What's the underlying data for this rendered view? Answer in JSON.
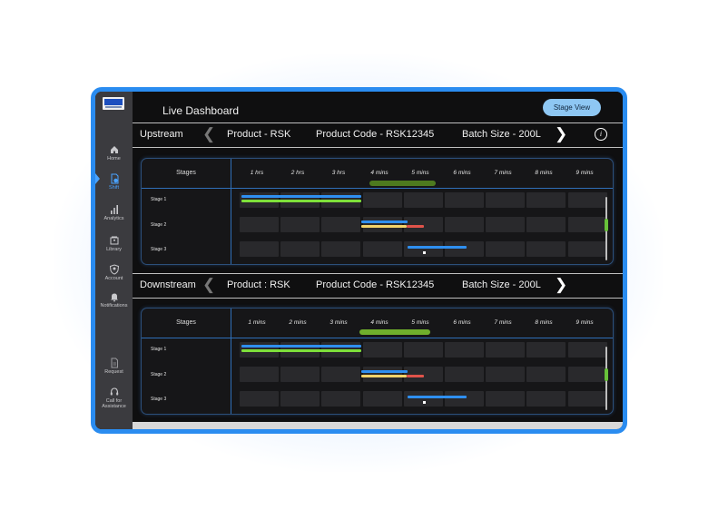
{
  "app": {
    "title": "Live Dashboard",
    "stage_view_label": "Stage View"
  },
  "sidebar": {
    "items": [
      {
        "label": "Home",
        "icon": "home-icon",
        "active": false
      },
      {
        "label": "Shift",
        "icon": "shift-icon",
        "active": true
      },
      {
        "label": "Analytics",
        "icon": "analytics-icon",
        "active": false
      },
      {
        "label": "Library",
        "icon": "library-icon",
        "active": false
      },
      {
        "label": "Account",
        "icon": "account-icon",
        "active": false
      },
      {
        "label": "Notifications",
        "icon": "bell-icon",
        "active": false
      },
      {
        "label": "Request",
        "icon": "request-icon",
        "active": false
      },
      {
        "label": "Call for Assistance",
        "icon": "headset-icon",
        "active": false
      }
    ]
  },
  "upstream": {
    "section": "Upstream",
    "product": "Product - RSK",
    "product_code": "Product Code  - RSK12345",
    "batch_size": "Batch Size  - 200L",
    "stages_header": "Stages",
    "ticks": [
      "1 hrs",
      "2 hrs",
      "3 hrs",
      "4 mins",
      "5 mins",
      "6 mins",
      "7 mins",
      "8 mins",
      "9 mins"
    ],
    "stages": [
      "Stage 1",
      "Stage 2",
      "Stage 3"
    ]
  },
  "downstream": {
    "section": "Downstream",
    "product": "Product : RSK",
    "product_code": "Product Code  - RSK12345",
    "batch_size": "Batch Size  - 200L",
    "stages_header": "Stages",
    "ticks": [
      "1 mins",
      "2 mins",
      "3 mins",
      "4 mins",
      "5 mins",
      "6 mins",
      "7 mins",
      "8 mins",
      "9 mins"
    ],
    "stages": [
      "Stage 1",
      "Stage 2",
      "Stage 3"
    ]
  },
  "colors": {
    "accent": "#2a8cf0",
    "blue_bar": "#2f8ff0",
    "green_bar": "#7ee03a",
    "yellow_bar": "#f3d36b",
    "red_bar": "#e0534a",
    "highlight_up": "#4d7a1f",
    "highlight_down": "#6fae2c"
  }
}
